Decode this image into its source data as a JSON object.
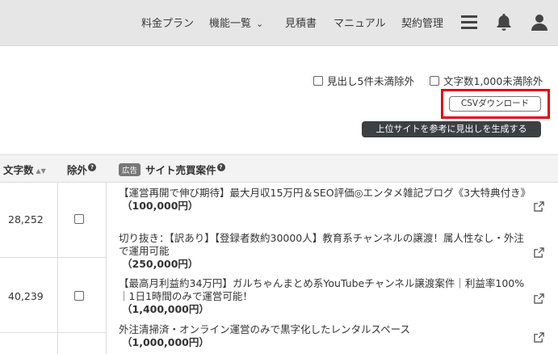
{
  "nav": {
    "items": [
      "料金プラン",
      "機能一覧",
      "見積書",
      "マニュアル",
      "契約管理"
    ],
    "chevron": "⌄",
    "icons": [
      "menu-icon",
      "bell-icon",
      "user-icon"
    ]
  },
  "filters": {
    "headings": "見出し5件未満除外",
    "chars": "文字数1,000未満除外"
  },
  "buttons": {
    "csv": "CSVダウンロード",
    "generate": "上位サイトを参考に見出しを生成する"
  },
  "table": {
    "col_chars": "文字数",
    "col_exclude": "除外",
    "ad_badge": "広告",
    "col_listings": "サイト売買案件",
    "help": "?",
    "sort": "▲▼"
  },
  "rows": [
    {
      "chars": "28,252"
    },
    {
      "chars": "40,239"
    }
  ],
  "listings": [
    {
      "title": "【運営再開で伸び期待】最大月収15万円＆SEO評価◎エンタメ雑記ブログ《3大特典付き》",
      "price": "（100,000円）"
    },
    {
      "title": "切り抜き：【訳あり】【登録者数約30000人】教育系チャンネルの譲渡！属人性なし・外注で運用可能",
      "price": "（250,000円）"
    },
    {
      "title": "【最高月利益約34万円】ガルちゃんまとめ系YouTubeチャンネル譲渡案件｜利益率100%｜1日1時間のみで運営可能！",
      "price": "（1,400,000円）"
    },
    {
      "title": "外注清掃済・オンライン運営のみで黒字化したレンタルスペース",
      "price": "（1,000,000円）"
    }
  ],
  "colors": {
    "highlight": "#e60012",
    "nav_bg": "#e6e6e6",
    "dark_button": "#3c4043"
  }
}
